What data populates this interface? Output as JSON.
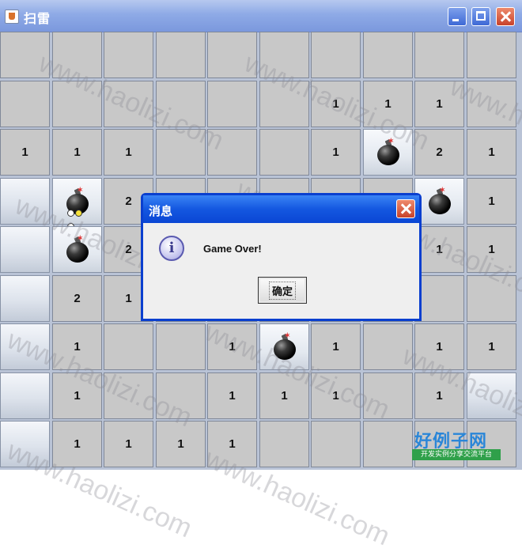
{
  "window": {
    "title": "扫雷",
    "controls": [
      "minimize",
      "maximize",
      "close"
    ]
  },
  "board": {
    "rows": 9,
    "cols": 10,
    "cells": [
      [
        "",
        "",
        "",
        "",
        "",
        "",
        "",
        "",
        "",
        ""
      ],
      [
        "",
        "",
        "",
        "",
        "",
        "",
        "1",
        "1",
        "1",
        ""
      ],
      [
        "1",
        "1",
        "1",
        "",
        "",
        "",
        "1",
        "M",
        "2",
        "1"
      ],
      [
        "C",
        "X",
        "2",
        "",
        "",
        "",
        "",
        "",
        "M",
        "1"
      ],
      [
        "C",
        "M",
        "2",
        "",
        "",
        "",
        "",
        "",
        "1",
        "1"
      ],
      [
        "C",
        "2",
        "1",
        "",
        "",
        "",
        "",
        "",
        "",
        ""
      ],
      [
        "C",
        "1",
        "",
        "",
        "1",
        "M",
        "1",
        "",
        "1",
        "1"
      ],
      [
        "C",
        "1",
        "",
        "",
        "1",
        "1",
        "1",
        "",
        "1",
        "C"
      ],
      [
        "C",
        "1",
        "1",
        "1",
        "1",
        "",
        "",
        "",
        "",
        ""
      ]
    ],
    "legend": {
      "M": "mine",
      "X": "exploded-mine",
      "C": "covered",
      "": "empty"
    }
  },
  "watermark": "www.haolizi.com",
  "dialog": {
    "title": "消息",
    "message": "Game Over!",
    "ok_label": "确定",
    "icon": "information-icon"
  },
  "brand": {
    "name": "好例子网",
    "tagline": "开发实例分享交流平台"
  }
}
